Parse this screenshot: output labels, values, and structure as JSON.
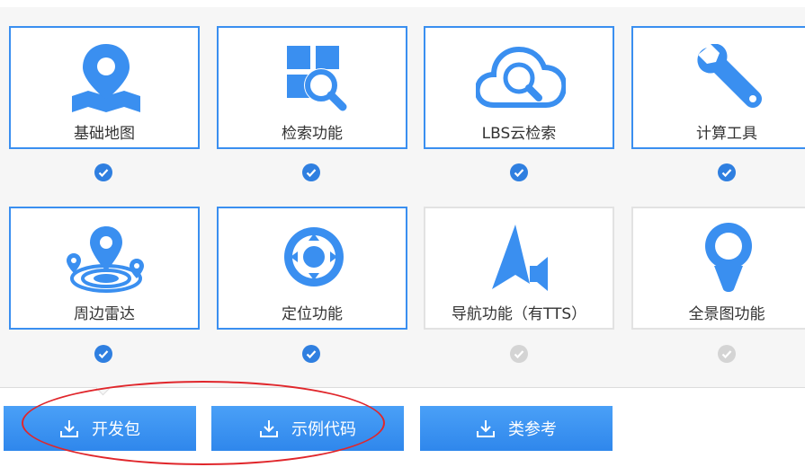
{
  "features": [
    {
      "id": "basic-map",
      "label": "基础地图",
      "icon": "map-pin-icon",
      "checked": true
    },
    {
      "id": "search",
      "label": "检索功能",
      "icon": "search-grid-icon",
      "checked": true
    },
    {
      "id": "lbs-cloud",
      "label": "LBS云检索",
      "icon": "cloud-search-icon",
      "checked": true
    },
    {
      "id": "compute-tools",
      "label": "计算工具",
      "icon": "wrench-icon",
      "checked": true
    },
    {
      "id": "radar",
      "label": "周边雷达",
      "icon": "radar-icon",
      "checked": true
    },
    {
      "id": "location",
      "label": "定位功能",
      "icon": "crosshair-icon",
      "checked": true
    },
    {
      "id": "navigation",
      "label": "导航功能（有TTS）",
      "icon": "navigation-arrow-icon",
      "checked": false
    },
    {
      "id": "panorama",
      "label": "全景图功能",
      "icon": "panorama-pin-icon",
      "checked": false
    }
  ],
  "buttons": {
    "dev_pack": "开发包",
    "sample_code": "示例代码",
    "class_reference": "类参考"
  },
  "colors": {
    "accent": "#3a8ff0",
    "check_on": "#2f7fe0",
    "check_off": "#d4d4d4",
    "annotation": "#e0262b"
  }
}
